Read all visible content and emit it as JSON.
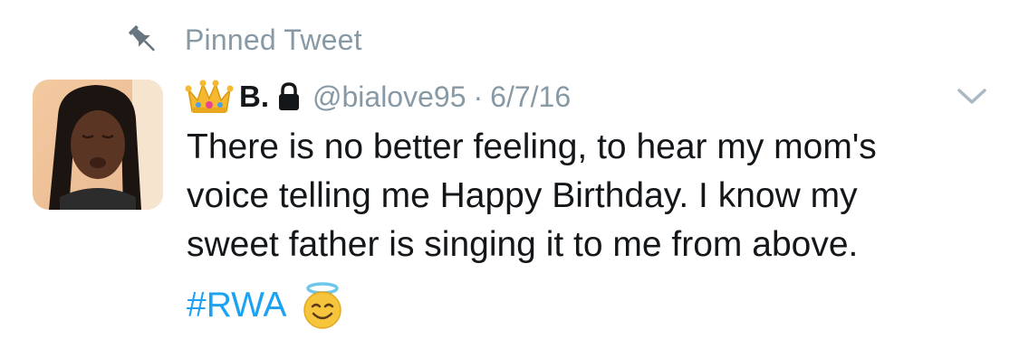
{
  "pinned": {
    "icon": "pin-icon",
    "label": "Pinned Tweet"
  },
  "tweet": {
    "avatar": "avatar",
    "crown_emoji": "crown-emoji",
    "display_name": "B.",
    "lock_icon": "lock-icon",
    "handle": "@bialove95",
    "separator": "·",
    "date": "6/7/16",
    "menu_icon": "chevron-down-icon",
    "text_lines": [
      "There is no better feeling, to hear my mom's",
      "voice telling me Happy Birthday. I know my",
      "sweet father is singing it to me from above."
    ],
    "hashtag": "#RWA",
    "trailing_emoji": "smiling-face-with-halo-emoji"
  },
  "colors": {
    "text_primary": "#14171a",
    "text_secondary": "#8899a6",
    "link": "#1da1f2",
    "background": "#ffffff"
  }
}
